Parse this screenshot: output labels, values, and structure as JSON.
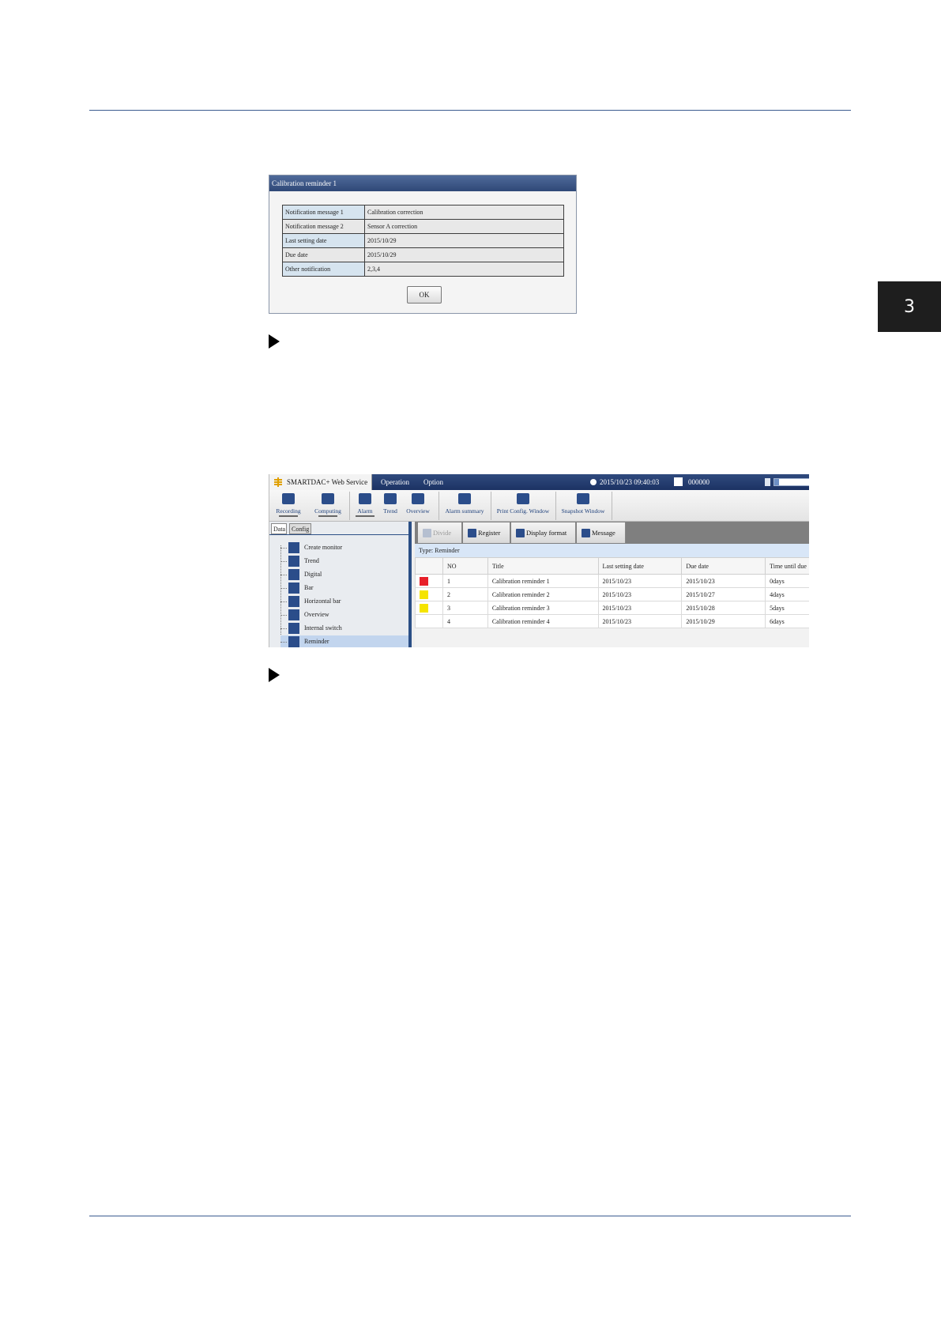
{
  "page": {
    "chapter_number": "3"
  },
  "dialog": {
    "title": "Calibration reminder 1",
    "rows": [
      {
        "label": "Notification message 1",
        "value": "Calibration correction"
      },
      {
        "label": "Notification message 2",
        "value": "Sensor A correction"
      },
      {
        "label": "Last setting date",
        "value": "2015/10/29"
      },
      {
        "label": "Due date",
        "value": "2015/10/29"
      },
      {
        "label": "Other notification",
        "value": "2,3,4"
      }
    ],
    "ok_label": "OK"
  },
  "app": {
    "title": "SMARTDAC+ Web Service",
    "menu": {
      "operation": "Operation",
      "option": "Option"
    },
    "datetime": "2015/10/23 09:40:03",
    "user_id": "000000",
    "toolbar": [
      {
        "label": "Recording",
        "icon": "recording-icon"
      },
      {
        "label": "Computing",
        "icon": "computing-icon"
      },
      {
        "label": "Alarm",
        "icon": "alarm-icon"
      },
      {
        "label": "Trend",
        "icon": "trend-icon"
      },
      {
        "label": "Overview",
        "icon": "overview-icon"
      },
      {
        "label": "Alarm summary",
        "icon": "alarm-summary-icon"
      },
      {
        "label": "Print Config. Window",
        "icon": "print-icon"
      },
      {
        "label": "Snapshot Window",
        "icon": "camera-icon"
      }
    ],
    "side_tabs": {
      "data": "Data",
      "config": "Config"
    },
    "tree": [
      {
        "label": "Create monitor",
        "icon": "create-monitor-icon"
      },
      {
        "label": "Trend",
        "icon": "trend-icon"
      },
      {
        "label": "Digital",
        "icon": "digital-icon"
      },
      {
        "label": "Bar",
        "icon": "bar-icon"
      },
      {
        "label": "Horizontal bar",
        "icon": "horizontal-bar-icon"
      },
      {
        "label": "Overview",
        "icon": "overview-icon"
      },
      {
        "label": "Internal switch",
        "icon": "internal-switch-icon"
      },
      {
        "label": "Reminder",
        "icon": "reminder-icon"
      }
    ],
    "main_toolbar": {
      "divide": "Divide",
      "register": "Register",
      "display_format": "Display format",
      "message": "Message"
    },
    "type_label": "Type: Reminder",
    "table": {
      "columns": [
        "",
        "NO",
        "Title",
        "Last setting date",
        "Due date",
        "Time until due"
      ],
      "rows": [
        {
          "status": "#e8202a",
          "no": "1",
          "title": "Calibration reminder 1",
          "last": "2015/10/23",
          "due": "2015/10/23",
          "until": "0days"
        },
        {
          "status": "#f5e400",
          "no": "2",
          "title": "Calibration reminder 2",
          "last": "2015/10/23",
          "due": "2015/10/27",
          "until": "4days"
        },
        {
          "status": "#f5e400",
          "no": "3",
          "title": "Calibration reminder 3",
          "last": "2015/10/23",
          "due": "2015/10/28",
          "until": "5days"
        },
        {
          "status": "",
          "no": "4",
          "title": "Calibration reminder 4",
          "last": "2015/10/23",
          "due": "2015/10/29",
          "until": "6days"
        }
      ]
    },
    "colors": {
      "accent": "#2b4f86",
      "menubar": "#1c3263"
    }
  }
}
